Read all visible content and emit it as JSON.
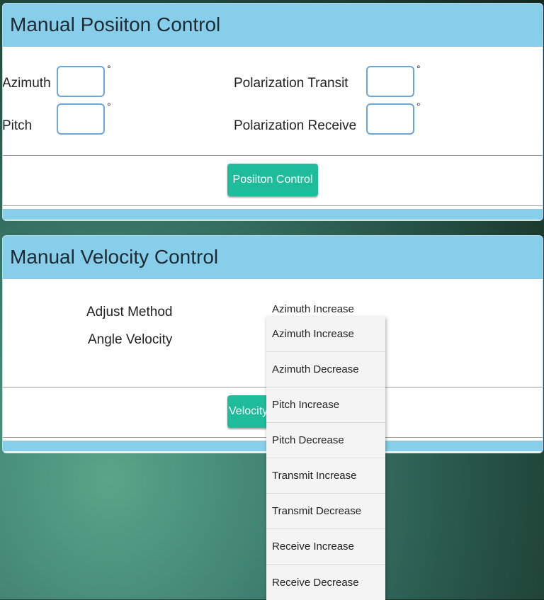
{
  "position_panel": {
    "title": "Manual Posiiton Control",
    "azimuth_label": "Azimuth",
    "pitch_label": "Pitch",
    "pol_transit_label": "Polarization Transit",
    "pol_receive_label": "Polarization Receive",
    "degree_symbol": "°",
    "azimuth_value": "",
    "pitch_value": "",
    "pol_transit_value": "",
    "pol_receive_value": "",
    "button_label": "Posiiton Control"
  },
  "velocity_panel": {
    "title": "Manual Velocity Control",
    "adjust_method_label": "Adjust Method",
    "angle_velocity_label": "Angle Velocity",
    "selected_method": "Azimuth Increase",
    "button_label": "Velocity Control"
  },
  "dropdown": {
    "options": [
      "Azimuth Increase",
      "Azimuth Decrease",
      "Pitch Increase",
      "Pitch Decrease",
      "Transmit Increase",
      "Transmit Decrease",
      "Receive Increase",
      "Receive Decrease"
    ]
  },
  "colors": {
    "header_bg": "#87ceeb",
    "button_bg": "#1fbc9c",
    "input_border": "#6aa6d8"
  }
}
